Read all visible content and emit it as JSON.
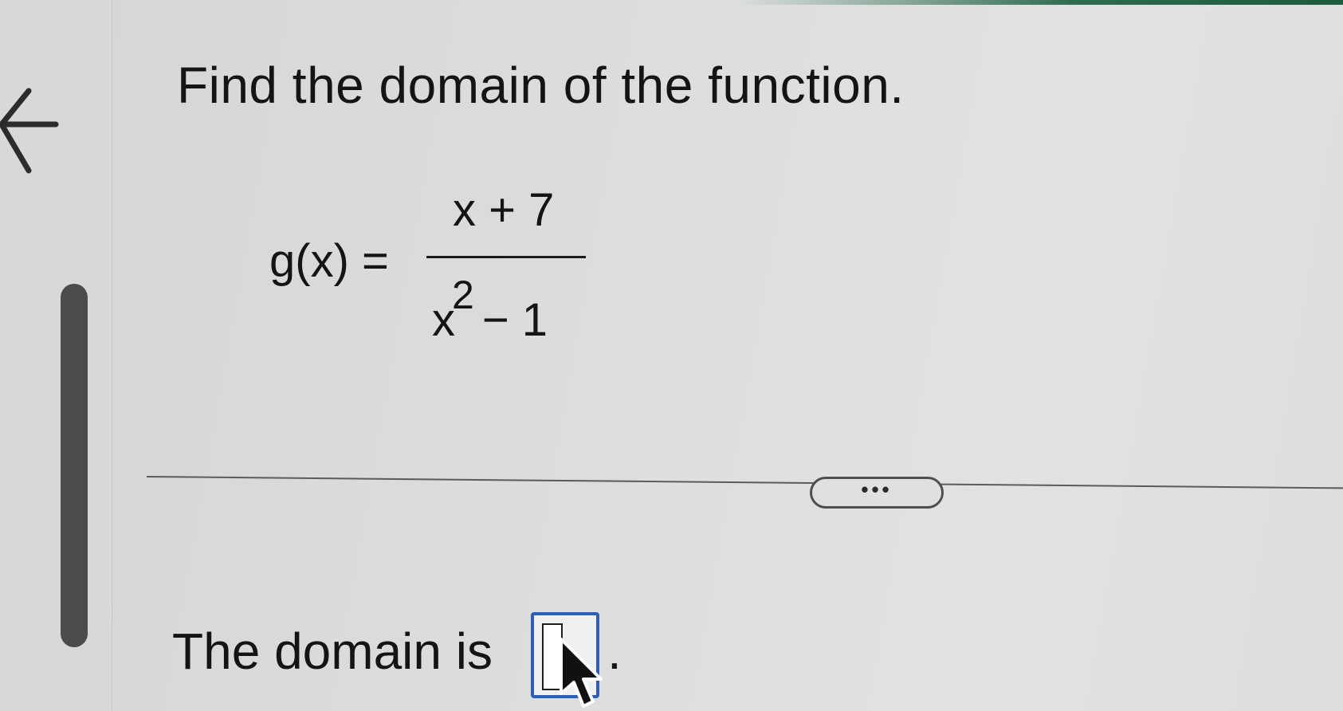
{
  "navigation": {
    "back_icon": "arrow-left-icon"
  },
  "question": {
    "prompt": "Find the domain of the function."
  },
  "formula": {
    "lhs": "g(x) =",
    "numerator": "x + 7",
    "denominator_base": "x",
    "denominator_exponent": "2",
    "denominator_rest": "− 1"
  },
  "divider": {
    "more_label": "•••"
  },
  "answer": {
    "label": "The domain is",
    "value": "",
    "trailing": "."
  },
  "colors": {
    "accent_bar": "#1f5a3e",
    "input_focus_border": "#2f5fb3",
    "scrollbar": "#4a4c4e"
  }
}
